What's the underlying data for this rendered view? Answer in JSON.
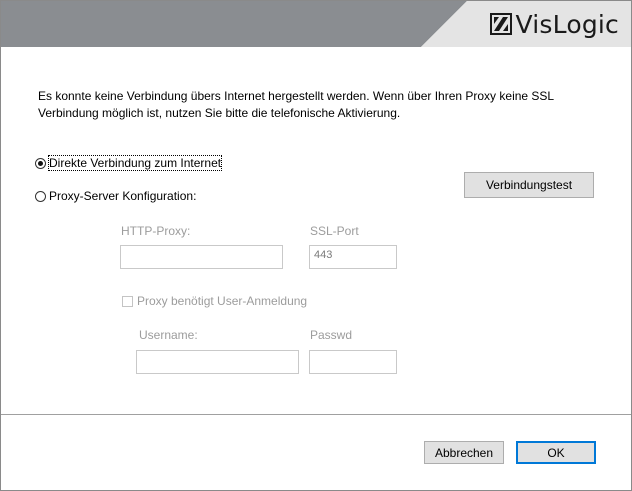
{
  "brand": {
    "name": "VisLogic",
    "header_color": "#8a8d91",
    "light_color": "#e4e4e4"
  },
  "message": "Es konnte keine Verbindung übers Internet hergestellt werden. Wenn über Ihren Proxy keine SSL Verbindung möglich ist, nutzen Sie bitte die telefonische Aktivierung.",
  "connection": {
    "direct_label": "Direkte Verbindung zum Internet",
    "direct_selected": true,
    "proxy_label": "Proxy-Server Konfiguration:",
    "proxy_selected": false
  },
  "test_button_label": "Verbindungstest",
  "proxy": {
    "http_proxy_label": "HTTP-Proxy:",
    "http_proxy_value": "",
    "ssl_port_label": "SSL-Port",
    "ssl_port_value": "443",
    "auth_checkbox_label": "Proxy benötigt User-Anmeldung",
    "auth_checked": false,
    "username_label": "Username:",
    "username_value": "",
    "password_label": "Passwd",
    "password_value": ""
  },
  "footer": {
    "cancel_label": "Abbrechen",
    "ok_label": "OK"
  }
}
